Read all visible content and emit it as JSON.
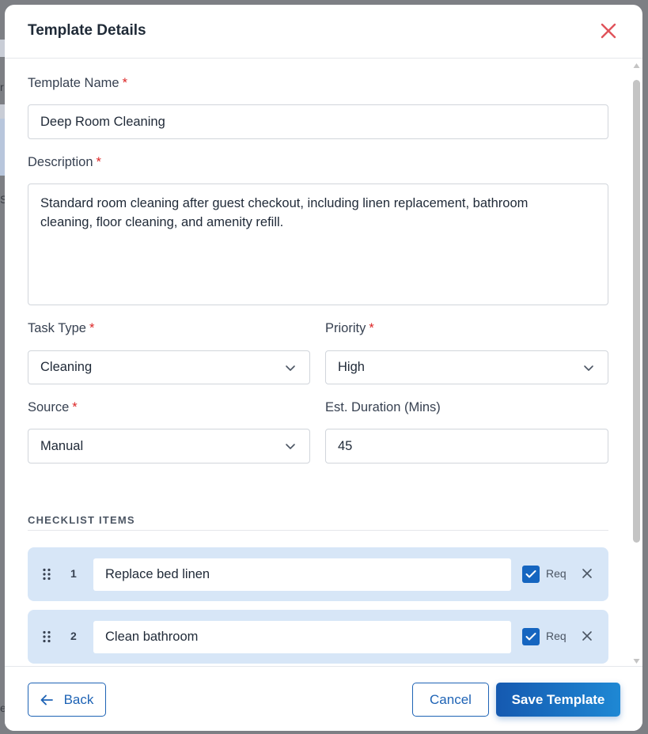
{
  "modal": {
    "title": "Template Details"
  },
  "form": {
    "template_name": {
      "label": "Template Name",
      "value": "Deep Room Cleaning"
    },
    "description": {
      "label": "Description",
      "value": "Standard room cleaning after guest checkout, including linen replacement, bathroom cleaning, floor cleaning, and amenity refill."
    },
    "task_type": {
      "label": "Task Type",
      "value": "Cleaning"
    },
    "priority": {
      "label": "Priority",
      "value": "High"
    },
    "source": {
      "label": "Source",
      "value": "Manual"
    },
    "est_duration": {
      "label": "Est. Duration (Mins)",
      "value": "45"
    },
    "required_marker": "*"
  },
  "checklist": {
    "title": "CHECKLIST ITEMS",
    "req_label": "Req",
    "items": [
      {
        "number": "1",
        "text": "Replace bed linen",
        "required": true
      },
      {
        "number": "2",
        "text": "Clean bathroom",
        "required": true
      }
    ]
  },
  "footer": {
    "back_label": "Back",
    "cancel_label": "Cancel",
    "save_label": "Save Template"
  },
  "background": {
    "chars": [
      "r",
      "S",
      "e"
    ]
  },
  "colors": {
    "primary": "#1e63b5",
    "required_star": "#dc2626",
    "close_icon": "#e0535a",
    "checklist_bg": "#d7e6f7"
  }
}
